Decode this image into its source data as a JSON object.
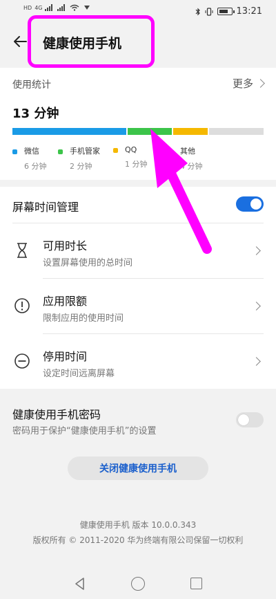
{
  "status_bar": {
    "left_tag_1": "HD",
    "left_tag_2": "HD",
    "network": "4G",
    "time": "13:21"
  },
  "header": {
    "title": "健康使用手机"
  },
  "stats": {
    "label": "使用统计",
    "more": "更多",
    "total": "13 分钟",
    "segments": [
      {
        "name": "微信",
        "value": "6 分钟",
        "color": "#1a9be6",
        "fraction": 0.46
      },
      {
        "name": "手机管家",
        "value": "2 分钟",
        "color": "#3cc44a",
        "fraction": 0.18
      },
      {
        "name": "QQ",
        "value": "1 分钟",
        "color": "#f5b800",
        "fraction": 0.14
      },
      {
        "name": "其他",
        "value": "4 分钟",
        "color": "#dddddd",
        "fraction": 0.22
      }
    ]
  },
  "management": {
    "title": "屏幕时间管理",
    "enabled": true,
    "items": [
      {
        "title": "可用时长",
        "subtitle": "设置屏幕使用的总时间",
        "icon": "hourglass-icon"
      },
      {
        "title": "应用限额",
        "subtitle": "限制应用的使用时间",
        "icon": "exclamation-circle-icon"
      },
      {
        "title": "停用时间",
        "subtitle": "设定时间远离屏幕",
        "icon": "minus-circle-icon"
      }
    ]
  },
  "password": {
    "title": "健康使用手机密码",
    "subtitle": "密码用于保护“健康使用手机”的设置",
    "enabled": false
  },
  "actions": {
    "close_label": "关闭健康使用手机"
  },
  "footer": {
    "version": "健康使用手机 版本 10.0.0.343",
    "copyright": "版权所有 © 2011-2020 华为终端有限公司保留一切权利"
  },
  "colors": {
    "accent": "#1a6fe0",
    "annotation": "#ff00ff"
  }
}
